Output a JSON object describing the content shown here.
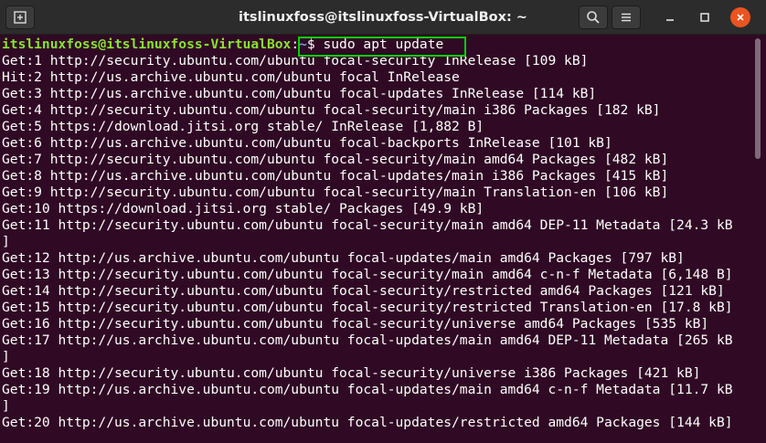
{
  "window": {
    "title": "itslinuxfoss@itslinuxfoss-VirtualBox: ~"
  },
  "toolbar": {
    "new_tab_icon": "new-tab-icon",
    "search_icon": "search-icon",
    "menu_icon": "hamburger-menu-icon",
    "minimize_icon": "minimize-icon",
    "maximize_icon": "maximize-icon",
    "close_icon": "close-icon"
  },
  "colors": {
    "background": "#300a24",
    "prompt_user": "#8ae234",
    "prompt_path": "#729fcf",
    "highlight_box": "#00d000",
    "close_button": "#e95420"
  },
  "prompt": {
    "user_host": "itslinuxfoss@itslinuxfoss-VirtualBox",
    "separator": ":",
    "path": "~",
    "symbol": "$ ",
    "command": "sudo apt update"
  },
  "output": [
    "Get:1 http://security.ubuntu.com/ubuntu focal-security InRelease [109 kB]",
    "Hit:2 http://us.archive.ubuntu.com/ubuntu focal InRelease",
    "Get:3 http://us.archive.ubuntu.com/ubuntu focal-updates InRelease [114 kB]",
    "Get:4 http://security.ubuntu.com/ubuntu focal-security/main i386 Packages [182 kB]",
    "Get:5 https://download.jitsi.org stable/ InRelease [1,882 B]",
    "Get:6 http://us.archive.ubuntu.com/ubuntu focal-backports InRelease [101 kB]",
    "Get:7 http://security.ubuntu.com/ubuntu focal-security/main amd64 Packages [482 kB]",
    "Get:8 http://us.archive.ubuntu.com/ubuntu focal-updates/main i386 Packages [415 kB]",
    "Get:9 http://security.ubuntu.com/ubuntu focal-security/main Translation-en [106 kB]",
    "Get:10 https://download.jitsi.org stable/ Packages [49.9 kB]",
    "Get:11 http://security.ubuntu.com/ubuntu focal-security/main amd64 DEP-11 Metadata [24.3 kB",
    "]",
    "Get:12 http://us.archive.ubuntu.com/ubuntu focal-updates/main amd64 Packages [797 kB]",
    "Get:13 http://security.ubuntu.com/ubuntu focal-security/main amd64 c-n-f Metadata [6,148 B]",
    "Get:14 http://security.ubuntu.com/ubuntu focal-security/restricted amd64 Packages [121 kB]",
    "Get:15 http://security.ubuntu.com/ubuntu focal-security/restricted Translation-en [17.8 kB]",
    "Get:16 http://security.ubuntu.com/ubuntu focal-security/universe amd64 Packages [535 kB]",
    "Get:17 http://us.archive.ubuntu.com/ubuntu focal-updates/main amd64 DEP-11 Metadata [265 kB",
    "]",
    "Get:18 http://security.ubuntu.com/ubuntu focal-security/universe i386 Packages [421 kB]",
    "Get:19 http://us.archive.ubuntu.com/ubuntu focal-updates/main amd64 c-n-f Metadata [11.7 kB",
    "]",
    "Get:20 http://us.archive.ubuntu.com/ubuntu focal-updates/restricted amd64 Packages [144 kB]"
  ]
}
